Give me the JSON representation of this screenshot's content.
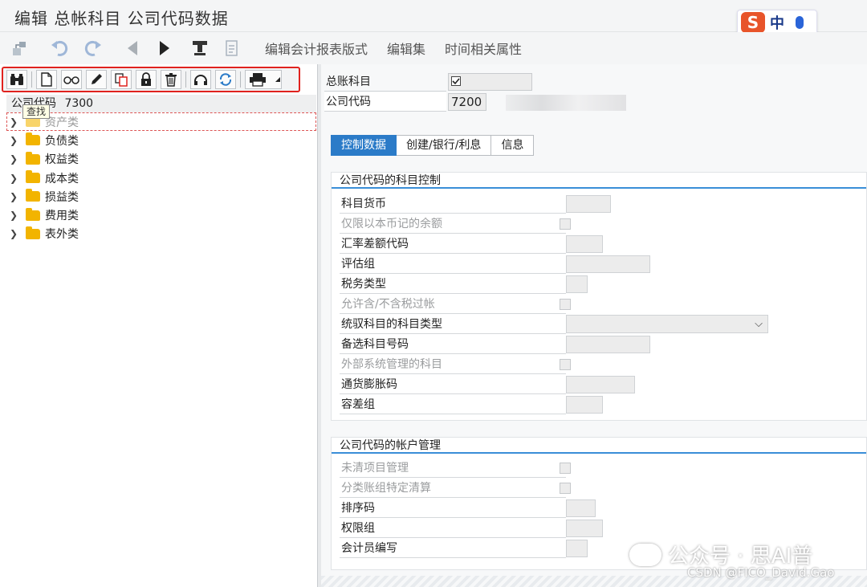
{
  "window": {
    "title": "编辑 总帐科目 公司代码数据"
  },
  "ime": {
    "logo": "S",
    "mode": "中"
  },
  "app_toolbar": {
    "icons": [
      "tree-icon",
      "undo-icon",
      "redo-icon",
      "prev-icon",
      "next-icon",
      "stamp-icon",
      "document-icon"
    ],
    "menu": [
      "编辑会计报表版式",
      "编辑集",
      "时间相关属性"
    ]
  },
  "tree_toolbar": {
    "icons": [
      "binoculars-icon",
      "new-document-icon",
      "glasses-icon",
      "pencil-icon",
      "copy-icon",
      "lock-icon",
      "trash-icon",
      "unlock-icon",
      "refresh-icon",
      "print-icon"
    ]
  },
  "tree": {
    "header_label": "公司代码",
    "header_value": "7300",
    "tooltip": "查找",
    "items": [
      "资产类",
      "负债类",
      "权益类",
      "成本类",
      "损益类",
      "费用类",
      "表外类"
    ]
  },
  "header": {
    "gl_account_label": "总账科目",
    "company_code_label": "公司代码",
    "company_code_value": "7200"
  },
  "tabs": [
    "控制数据",
    "创建/银行/利息",
    "信息"
  ],
  "account_control": {
    "title": "公司代码的科目控制",
    "fields": [
      {
        "label": "科目货币",
        "type": "input",
        "disabled": false
      },
      {
        "label": "仅限以本币记的余额",
        "type": "checkbox",
        "disabled": true
      },
      {
        "label": "汇率差额代码",
        "type": "input",
        "disabled": false
      },
      {
        "label": "评估组",
        "type": "input",
        "disabled": false
      },
      {
        "label": "税务类型",
        "type": "input",
        "disabled": false
      },
      {
        "label": "允许含/不含税过帐",
        "type": "checkbox",
        "disabled": true
      },
      {
        "label": "统驭科目的科目类型",
        "type": "select",
        "disabled": false
      },
      {
        "label": "备选科目号码",
        "type": "input",
        "disabled": false
      },
      {
        "label": "外部系统管理的科目",
        "type": "checkbox",
        "disabled": true
      },
      {
        "label": "通货膨胀码",
        "type": "input",
        "disabled": false
      },
      {
        "label": "容差组",
        "type": "input",
        "disabled": false
      }
    ]
  },
  "account_management": {
    "title": "公司代码的帐户管理",
    "fields": [
      {
        "label": "未清项目管理",
        "type": "checkbox",
        "disabled": true
      },
      {
        "label": "分类账组特定清算",
        "type": "checkbox",
        "disabled": true
      },
      {
        "label": "排序码",
        "type": "input",
        "disabled": false
      },
      {
        "label": "权限组",
        "type": "input",
        "disabled": false
      },
      {
        "label": "会计员编写",
        "type": "input",
        "disabled": false
      }
    ]
  },
  "watermark": {
    "text": "公众号 · 思AI普",
    "credit": "CSDN @FICO_David.Gao"
  },
  "colors": {
    "accent": "#2b7bc8",
    "highlight": "#e0221e",
    "folder": "#f2b400"
  }
}
